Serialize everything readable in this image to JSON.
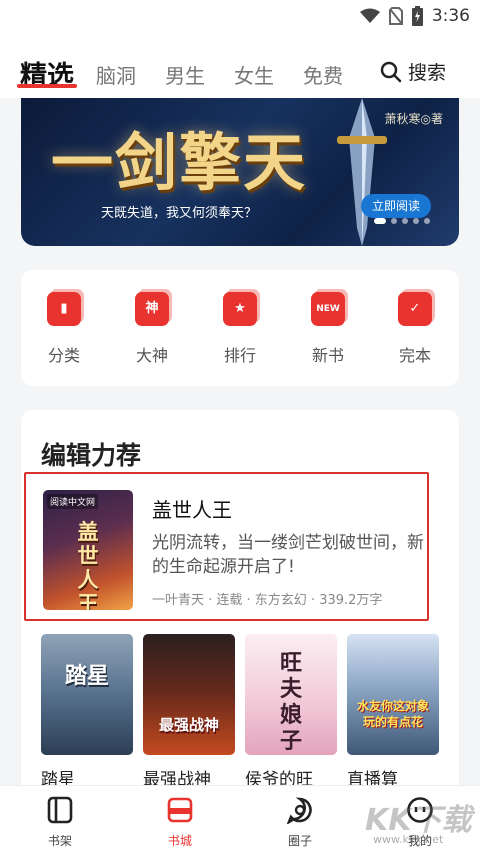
{
  "status": {
    "time": "3:36"
  },
  "tabs": [
    {
      "label": "精选",
      "active": true
    },
    {
      "label": "脑洞",
      "active": false
    },
    {
      "label": "男生",
      "active": false
    },
    {
      "label": "女生",
      "active": false
    },
    {
      "label": "免费",
      "active": false
    }
  ],
  "search": {
    "label": "搜索"
  },
  "banner": {
    "title": "一剑擎天",
    "author": "萧秋寒◎著",
    "tagline": "天既失道，我又何须奉天？",
    "cta": "立即阅读"
  },
  "categories": [
    {
      "label": "分类",
      "icon": "bookmark-icon",
      "glyph": ""
    },
    {
      "label": "大神",
      "icon": "shen-icon",
      "glyph": "神"
    },
    {
      "label": "排行",
      "icon": "trophy-icon",
      "glyph": "★"
    },
    {
      "label": "新书",
      "icon": "new-icon",
      "glyph": "NEW"
    },
    {
      "label": "完本",
      "icon": "check-icon",
      "glyph": "✓"
    }
  ],
  "picks": {
    "title": "编辑力荐",
    "featured": {
      "title": "盖世人王",
      "description": "光阴流转，当一缕剑芒划破世间，新的生命起源开启了!",
      "meta": "一叶青天 · 连载 · 东方玄幻 · 339.2万字",
      "cover_text": "盖世人王",
      "cover_tag": "阅读中文网"
    },
    "books": [
      {
        "title": "踏星",
        "cover_text": "踏星"
      },
      {
        "title": "最强战神",
        "cover_text": "最强战神"
      },
      {
        "title": "侯爷的旺",
        "cover_text": "旺夫娘子"
      },
      {
        "title": "直播算",
        "cover_text": "水友你这对象玩的有点花"
      }
    ]
  },
  "bottom_nav": [
    {
      "label": "书架",
      "icon": "bookshelf-icon",
      "active": false
    },
    {
      "label": "书城",
      "icon": "bookstore-icon",
      "active": true
    },
    {
      "label": "圈子",
      "icon": "community-icon",
      "active": false
    },
    {
      "label": "我的",
      "icon": "profile-icon",
      "active": false
    }
  ],
  "watermark": {
    "text": "KK下载",
    "url": "www.kkx.net"
  },
  "colors": {
    "accent": "#e8332f",
    "banner_cta": "#1976d2"
  }
}
